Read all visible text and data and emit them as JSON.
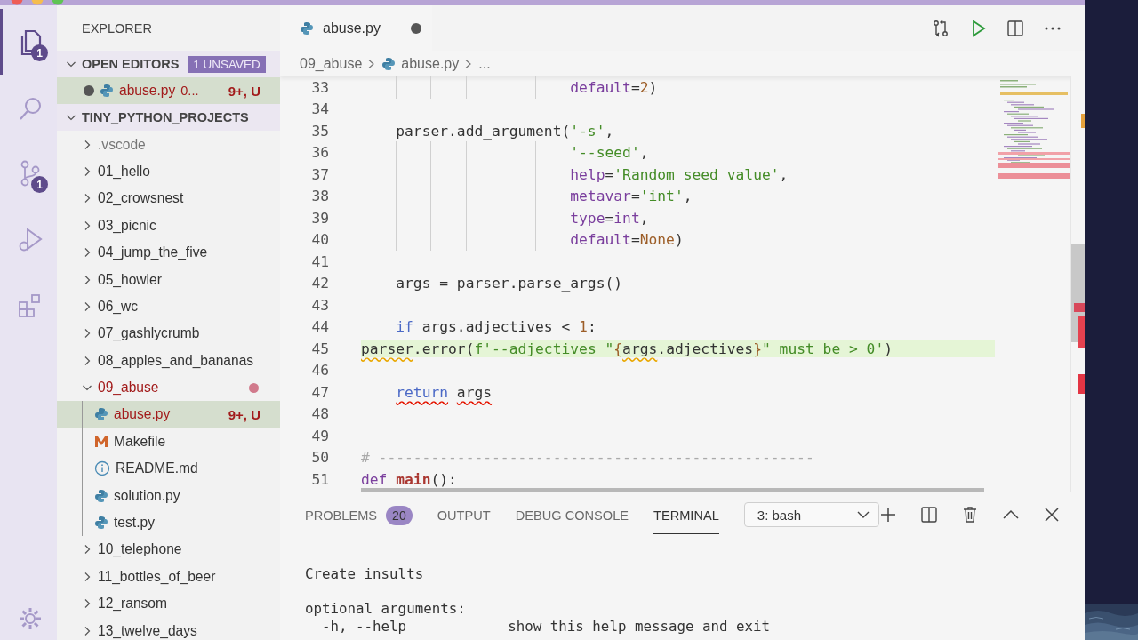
{
  "activity_bar": [
    {
      "kind": "explorer",
      "selected": true,
      "badge": "1"
    },
    {
      "kind": "search",
      "selected": false
    },
    {
      "kind": "source-control",
      "selected": false,
      "badge": "1"
    },
    {
      "kind": "run",
      "selected": false
    },
    {
      "kind": "extensions",
      "selected": false
    },
    {
      "kind": "settings",
      "selected": false
    }
  ],
  "sidebar": {
    "title": "EXPLORER",
    "sections": [
      {
        "title": "OPEN EDITORS",
        "expanded": true,
        "badge": "1 UNSAVED",
        "editors": [
          {
            "label": "abuse.py",
            "kind": "python",
            "description": "0...",
            "status": "9+, U",
            "dirty": true,
            "selected": true,
            "has_errors": true
          }
        ]
      },
      {
        "title": "TINY_PYTHON_PROJECTS",
        "expanded": true,
        "items": [
          {
            "label": ".vscode",
            "kind": "folder",
            "expanded": false,
            "selected": false,
            "has_errors": false,
            "dimmed": true
          },
          {
            "label": "01_hello",
            "kind": "folder",
            "expanded": false,
            "selected": false,
            "has_errors": false
          },
          {
            "label": "02_crowsnest",
            "kind": "folder",
            "expanded": false,
            "selected": false,
            "has_errors": false
          },
          {
            "label": "03_picnic",
            "kind": "folder",
            "expanded": false,
            "selected": false,
            "has_errors": false
          },
          {
            "label": "04_jump_the_five",
            "kind": "folder",
            "expanded": false,
            "selected": false,
            "has_errors": false
          },
          {
            "label": "05_howler",
            "kind": "folder",
            "expanded": false,
            "selected": false,
            "has_errors": false
          },
          {
            "label": "06_wc",
            "kind": "folder",
            "expanded": false,
            "selected": false,
            "has_errors": false
          },
          {
            "label": "07_gashlycrumb",
            "kind": "folder",
            "expanded": false,
            "selected": false,
            "has_errors": false
          },
          {
            "label": "08_apples_and_bananas",
            "kind": "folder",
            "expanded": false,
            "selected": false,
            "has_errors": false
          },
          {
            "label": "09_abuse",
            "kind": "folder",
            "expanded": true,
            "selected": false,
            "has_errors": true,
            "children": [
              {
                "label": "abuse.py",
                "kind": "python",
                "selected": true,
                "has_errors": true,
                "status": "9+, U"
              },
              {
                "label": "Makefile",
                "kind": "makefile",
                "selected": false,
                "has_errors": false
              },
              {
                "label": "README.md",
                "kind": "readme",
                "selected": false,
                "has_errors": false
              },
              {
                "label": "solution.py",
                "kind": "python",
                "selected": false,
                "has_errors": false
              },
              {
                "label": "test.py",
                "kind": "python",
                "selected": false,
                "has_errors": false
              }
            ]
          },
          {
            "label": "10_telephone",
            "kind": "folder",
            "expanded": false,
            "selected": false,
            "has_errors": false
          },
          {
            "label": "11_bottles_of_beer",
            "kind": "folder",
            "expanded": false,
            "selected": false,
            "has_errors": false
          },
          {
            "label": "12_ransom",
            "kind": "folder",
            "expanded": false,
            "selected": false,
            "has_errors": false
          },
          {
            "label": "13_twelve_days",
            "kind": "folder",
            "expanded": false,
            "selected": false,
            "has_errors": false
          }
        ]
      }
    ]
  },
  "editor": {
    "tabs": [
      {
        "label": "abuse.py",
        "selected": true,
        "dirty": true
      }
    ],
    "actions": [
      {
        "kind": "compare"
      },
      {
        "kind": "run"
      },
      {
        "kind": "split"
      },
      {
        "kind": "more"
      }
    ],
    "breadcrumbs": [
      {
        "label": "09_abuse",
        "kind": "folder"
      },
      {
        "label": "abuse.py",
        "kind": "python"
      },
      {
        "label": "...",
        "kind": "symbol"
      }
    ],
    "lines": [
      {
        "number": "33",
        "tokens": [
          {
            "text": "                        default",
            "kind": "param"
          },
          {
            "text": "=",
            "kind": "plain"
          },
          {
            "text": "2",
            "kind": "number"
          },
          {
            "text": ")",
            "kind": "plain"
          }
        ]
      },
      {
        "number": "34"
      },
      {
        "number": "35",
        "tokens": [
          {
            "text": "    parser.add_argument(",
            "kind": "plain"
          },
          {
            "text": "'-s'",
            "kind": "string"
          },
          {
            "text": ",",
            "kind": "plain"
          }
        ]
      },
      {
        "number": "36",
        "tokens": [
          {
            "text": "                        '--seed'",
            "kind": "string"
          },
          {
            "text": ",",
            "kind": "plain"
          }
        ]
      },
      {
        "number": "37",
        "tokens": [
          {
            "text": "                        help",
            "kind": "param"
          },
          {
            "text": "=",
            "kind": "plain"
          },
          {
            "text": "'Random seed value'",
            "kind": "string"
          },
          {
            "text": ",",
            "kind": "plain"
          }
        ]
      },
      {
        "number": "38",
        "tokens": [
          {
            "text": "                        metavar",
            "kind": "param"
          },
          {
            "text": "=",
            "kind": "plain"
          },
          {
            "text": "'int'",
            "kind": "string"
          },
          {
            "text": ",",
            "kind": "plain"
          }
        ]
      },
      {
        "number": "39",
        "tokens": [
          {
            "text": "                        type",
            "kind": "param"
          },
          {
            "text": "=",
            "kind": "plain"
          },
          {
            "text": "int",
            "kind": "builtin"
          },
          {
            "text": ",",
            "kind": "plain"
          }
        ]
      },
      {
        "number": "40",
        "tokens": [
          {
            "text": "                        default",
            "kind": "param"
          },
          {
            "text": "=",
            "kind": "plain"
          },
          {
            "text": "None",
            "kind": "constant"
          },
          {
            "text": ")",
            "kind": "plain"
          }
        ]
      },
      {
        "number": "41"
      },
      {
        "number": "42",
        "tokens": [
          {
            "text": "    args = parser.parse_args()",
            "kind": "plain"
          }
        ]
      },
      {
        "number": "43"
      },
      {
        "number": "44",
        "tokens": [
          {
            "text": "    if",
            "kind": "keyword"
          },
          {
            "text": " args.adjectives < ",
            "kind": "plain"
          },
          {
            "text": "1",
            "kind": "number"
          },
          {
            "text": ":",
            "kind": "plain"
          }
        ]
      },
      {
        "number": "45",
        "current": true,
        "tokens": [
          {
            "text": "parser",
            "kind": "plain",
            "warning": true
          },
          {
            "text": ".error(",
            "kind": "plain"
          },
          {
            "text": "f'--adjectives \"",
            "kind": "string"
          },
          {
            "text": "{",
            "kind": "constant"
          },
          {
            "text": "args",
            "kind": "plain",
            "warning": true
          },
          {
            "text": ".adjectives",
            "kind": "plain"
          },
          {
            "text": "}",
            "kind": "constant"
          },
          {
            "text": "\" must be > 0'",
            "kind": "string"
          },
          {
            "text": ")",
            "kind": "plain"
          }
        ]
      },
      {
        "number": "46"
      },
      {
        "number": "47",
        "tokens": [
          {
            "text": "    return",
            "kind": "keyword",
            "error": true
          },
          {
            "text": " args",
            "kind": "plain",
            "error": true
          }
        ]
      },
      {
        "number": "48"
      },
      {
        "number": "49"
      },
      {
        "number": "50",
        "tokens": [
          {
            "text": "# --------------------------------------------------",
            "kind": "comment"
          }
        ]
      },
      {
        "number": "51",
        "tokens": [
          {
            "text": "def",
            "kind": "storage"
          },
          {
            "text": " main",
            "kind": "function"
          },
          {
            "text": "():",
            "kind": "plain"
          }
        ]
      }
    ]
  },
  "panel": {
    "tabs": [
      {
        "label": "PROBLEMS",
        "selected": false,
        "badge": "20"
      },
      {
        "label": "OUTPUT",
        "selected": false
      },
      {
        "label": "DEBUG CONSOLE",
        "selected": false
      },
      {
        "label": "TERMINAL",
        "selected": true
      }
    ],
    "terminal_select": {
      "value": "3: bash"
    },
    "actions": [
      {
        "kind": "new"
      },
      {
        "kind": "split"
      },
      {
        "kind": "trash"
      },
      {
        "kind": "maximize"
      },
      {
        "kind": "close"
      }
    ],
    "terminal_lines": [
      "Create insults",
      "optional arguments:",
      "  -h, --help            show this help message and exit"
    ]
  }
}
